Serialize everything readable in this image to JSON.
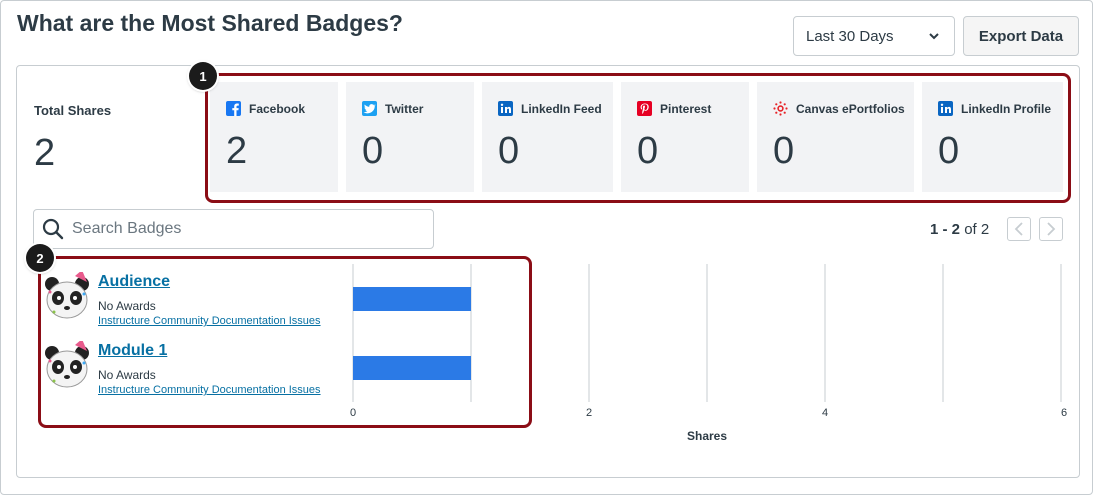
{
  "page": {
    "title": "What are the Most Shared Badges?"
  },
  "controls": {
    "range_value": "Last 30 Days",
    "export_label": "Export Data"
  },
  "totals": {
    "label": "Total Shares",
    "value": "2"
  },
  "platforms": [
    {
      "name": "Facebook",
      "value": "2",
      "icon": "facebook-icon",
      "color": "#1877f2"
    },
    {
      "name": "Twitter",
      "value": "0",
      "icon": "twitter-icon",
      "color": "#1da1f2"
    },
    {
      "name": "LinkedIn Feed",
      "value": "0",
      "icon": "linkedin-icon",
      "color": "#0a66c2"
    },
    {
      "name": "Pinterest",
      "value": "0",
      "icon": "pinterest-icon",
      "color": "#e60023"
    },
    {
      "name": "Canvas ePortfolios",
      "value": "0",
      "icon": "canvas-icon",
      "color": "#e72429"
    },
    {
      "name": "LinkedIn Profile",
      "value": "0",
      "icon": "linkedin-icon",
      "color": "#0a66c2"
    }
  ],
  "callouts": {
    "one": "1",
    "two": "2"
  },
  "search": {
    "placeholder": "Search Badges"
  },
  "pagination": {
    "range": "1 - 2",
    "suffix": "of 2"
  },
  "badges": [
    {
      "name": "Audience",
      "awards": "No Awards",
      "course": "Instructure Community Documentation Issues"
    },
    {
      "name": "Module 1",
      "awards": "No Awards",
      "course": "Instructure Community Documentation Issues"
    }
  ],
  "chart_data": {
    "type": "bar",
    "orientation": "horizontal",
    "categories": [
      "Audience",
      "Module 1"
    ],
    "values": [
      1,
      1
    ],
    "xlabel": "Shares",
    "ticks": [
      "0",
      "2",
      "4",
      "6"
    ],
    "xlim": [
      0,
      6
    ],
    "bar_color": "#2b7ae6",
    "grid": true
  }
}
